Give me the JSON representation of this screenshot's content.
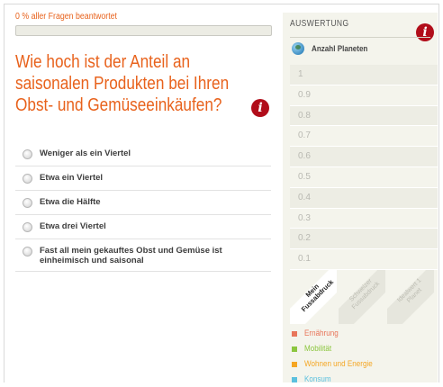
{
  "progress": {
    "label": "0 % aller Fragen beantwortet",
    "value_percent": 0
  },
  "question": {
    "text": "Wie hoch ist der Anteil an saisonalen Produkten bei Ihren Obst- und Gemüseeinkäufen?",
    "info_glyph": "i"
  },
  "answers": [
    {
      "label": "Weniger als ein Viertel"
    },
    {
      "label": "Etwa ein Viertel"
    },
    {
      "label": "Etwa die Hälfte"
    },
    {
      "label": "Etwa drei Viertel"
    },
    {
      "label": "Fast all mein gekauftes Obst und Gemüse ist einheimisch und saisonal"
    }
  ],
  "evaluation": {
    "title": "AUSWERTUNG",
    "info_glyph": "i",
    "metric_label": "Anzahl Planeten",
    "metric_icon": "globe-icon",
    "scale": [
      "1",
      "0.9",
      "0.8",
      "0.7",
      "0.6",
      "0.5",
      "0.4",
      "0.3",
      "0.2",
      "0.1"
    ],
    "tabs": [
      {
        "label": "Mein Fussabdruck",
        "active": true
      },
      {
        "label": "Schweizer Fussabdruck",
        "active": false
      },
      {
        "label": "Idealwert 1 Planet",
        "active": false
      }
    ],
    "legend": [
      {
        "label": "Ernährung",
        "color": "#e8755a"
      },
      {
        "label": "Mobilität",
        "color": "#8cc63f"
      },
      {
        "label": "Wohnen und Energie",
        "color": "#f5a623"
      },
      {
        "label": "Konsum",
        "color": "#5bc0de"
      }
    ]
  },
  "colors": {
    "accent": "#e8621c",
    "info": "#b10d1a",
    "panel": "#f4f4ec"
  }
}
